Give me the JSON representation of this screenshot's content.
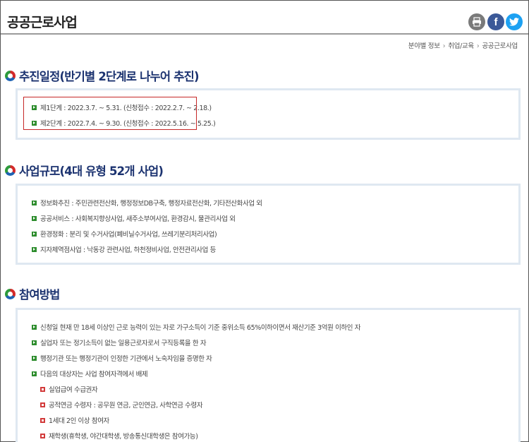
{
  "header": {
    "title": "공공근로사업",
    "share": {
      "print_icon": "print-icon",
      "facebook_icon": "facebook-icon",
      "twitter_icon": "twitter-icon",
      "facebook_glyph": "f"
    }
  },
  "breadcrumb": [
    "분야별 정보",
    "취업/교육",
    "공공근로사업"
  ],
  "sections": [
    {
      "title": "추진일정(반기별 2단계로 나누어 추진)",
      "items": [
        "제1단계 : 2022.3.7. ~ 5.31. (신청접수 : 2022.2.7. ~ 2.18.)",
        "제2단계 : 2022.7.4. ~ 9.30. (신청접수 : 2022.5.16. ~ 5.25.)"
      ]
    },
    {
      "title": "사업규모(4대 유형 52개 사업)",
      "items": [
        "정보화추진 : 주민관련전산화, 행정정보DB구축, 행정자료전산화, 기타전산화사업 외",
        "공공서비스 : 사회복지향상사업, 새주소부여사업, 환경감시, 물관리사업 외",
        "환경정화 : 분리 및 수거사업(폐비닐수거사업, 쓰레기분리처리사업)",
        "지자체역점사업 : 낙동강 관련사업, 하천정비사업, 안전관리사업 등"
      ]
    },
    {
      "title": "참여방법",
      "items": [
        "신청일 현재 만 18세 이상인 근로 능력이 있는 자로 가구소득이 기준 중위소득 65%이하이면서 재산기준 3억원 이하인 자",
        "실업자 또는 정기소득이 없는 일용근로자로서 구직등록을 한 자",
        "행정기관 또는 행정기관이 인정한 기관에서 노숙자임을 증명한 자",
        "다음의 대상자는 사업 참여자격에서 배제"
      ],
      "subitems": [
        "실업급여 수급권자",
        "공적연금 수령자 : 공무원 연금, 군인연금, 사학연금 수령자",
        "1세대 2인 이상 참여자",
        "재학생(휴학생, 야간대학생, 방송통신대학생은 참여가능)"
      ]
    }
  ],
  "colors": {
    "title_blue": "#1c3370",
    "bullet_green": "#2c8c2c",
    "bullet_red": "#d23a3a",
    "highlight_red": "#c62828",
    "box_border": "#dfe8f1"
  }
}
